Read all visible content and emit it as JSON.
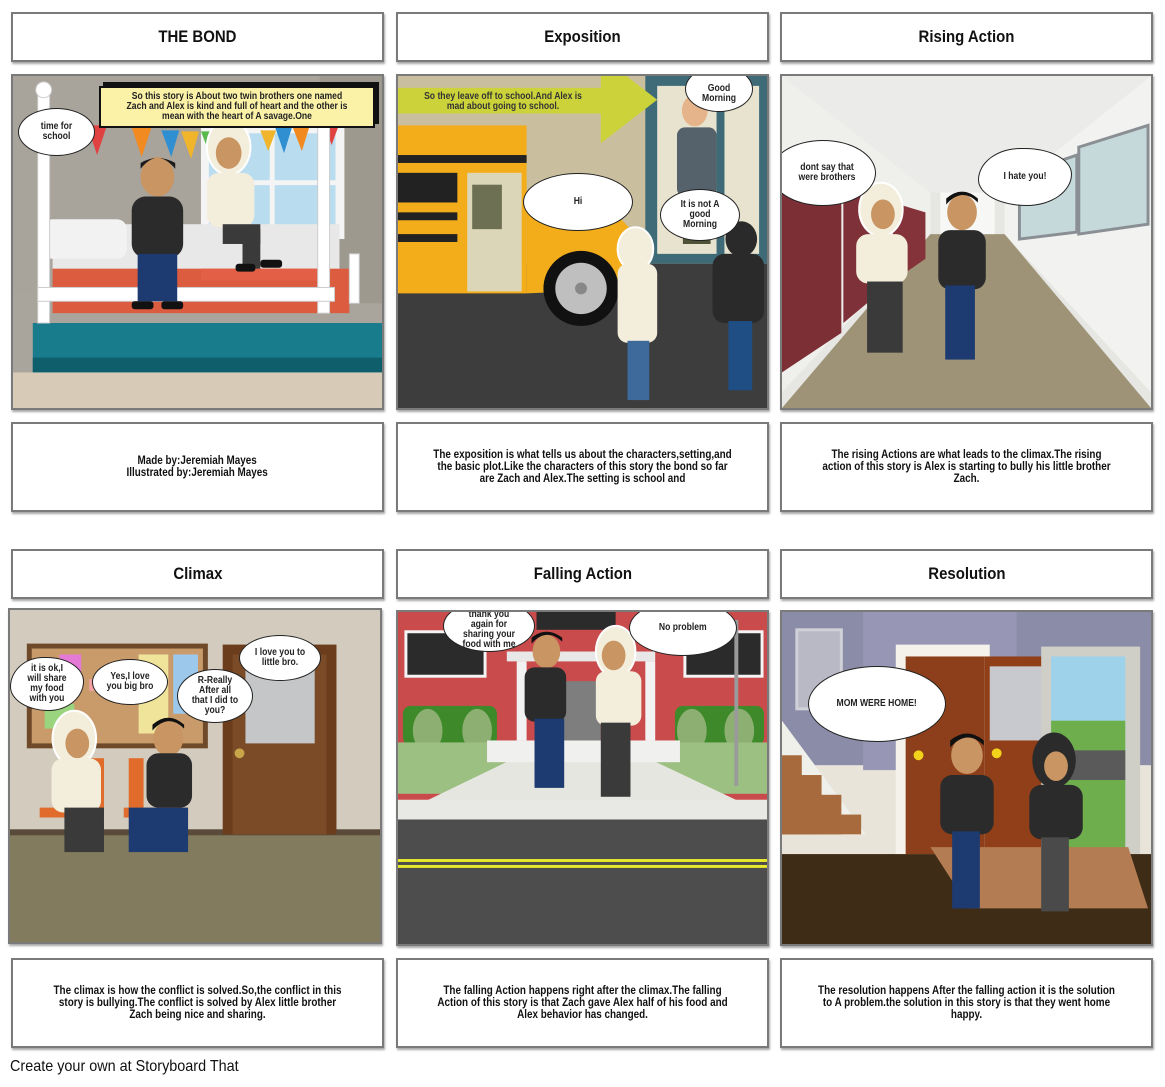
{
  "footer": "Create your own at Storyboard That",
  "cells": [
    {
      "title": "THE BOND",
      "description": "Made by:Jeremiah Mayes\nIllustrated by:Jeremiah Mayes",
      "narration": "So this story is About two twin brothers one named Zach and Alex is kind and full of heart and the other is mean with the heart of A savage.One",
      "bubbles": [
        "time for school"
      ]
    },
    {
      "title": "Exposition",
      "description": "The exposition is what tells us about the characters,setting,and the basic plot.Like the characters of this story the bond so far are Zach and Alex.The setting is school and",
      "narration": "So they leave off to school.And Alex is mad about going to school.",
      "bubbles": [
        "Good Morning",
        "Hi",
        "It is not A good Morning"
      ]
    },
    {
      "title": "Rising Action",
      "description": "The rising Actions are what leads to the climax.The rising action of this story is Alex is starting to bully his little brother Zach.",
      "bubbles": [
        "dont say that were brothers",
        "I hate you!"
      ]
    },
    {
      "title": "Climax",
      "description": "The climax is how the conflict is solved.So,the conflict in this story is bullying.The conflict is solved by Alex little brother Zach being nice and sharing.",
      "bubbles": [
        "it is ok,I will share my food with you",
        "Yes,I love you big bro",
        "R-Really After all that I did to you?",
        "I love you to little bro."
      ]
    },
    {
      "title": "Falling Action",
      "description": "The falling Action happens right after the climax.The falling Action of this story is that Zach gave Alex half of his food and Alex behavior has changed.",
      "bubbles": [
        "thank you again for sharing your food with me",
        "No problem"
      ]
    },
    {
      "title": "Resolution",
      "description": "The resolution happens After the falling action it is the solution to A problem.the solution in this story is that they went home happy.",
      "bubbles": [
        "MOM WERE HOME!"
      ]
    }
  ]
}
